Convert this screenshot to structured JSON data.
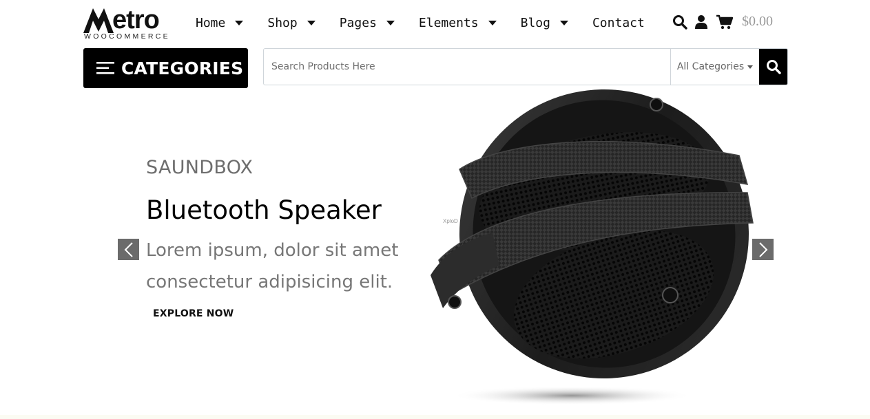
{
  "brand": {
    "name": "etro",
    "tagline": "WOOCOMMERCE"
  },
  "nav": {
    "items": [
      {
        "label": "Home",
        "has_dropdown": true
      },
      {
        "label": "Shop",
        "has_dropdown": true
      },
      {
        "label": "Pages",
        "has_dropdown": true
      },
      {
        "label": "Elements",
        "has_dropdown": true
      },
      {
        "label": "Blog",
        "has_dropdown": true
      },
      {
        "label": "Contact",
        "has_dropdown": false
      }
    ]
  },
  "header_icons": {
    "search": "search-icon",
    "account": "user-icon",
    "cart": "cart-icon",
    "cart_total": "$0.00"
  },
  "categories_button": {
    "label": "CATEGORIES",
    "icon": "hamburger-icon"
  },
  "search": {
    "placeholder": "Search Products Here",
    "value": "",
    "category_select": "All Categories",
    "button_icon": "search-icon"
  },
  "slide": {
    "subtitle": "SAUNDBOX",
    "title": "Bluetooth Speaker",
    "description": "Lorem ipsum, dolor sit amet consectetur adipisicing elit.",
    "cta": "EXPLORE NOW",
    "product_brand_mark": "XploD"
  },
  "colors": {
    "accent": "#000000",
    "muted_text": "#777777",
    "arrow_bg": "#6b6b6b",
    "cart_total": "#999999"
  }
}
